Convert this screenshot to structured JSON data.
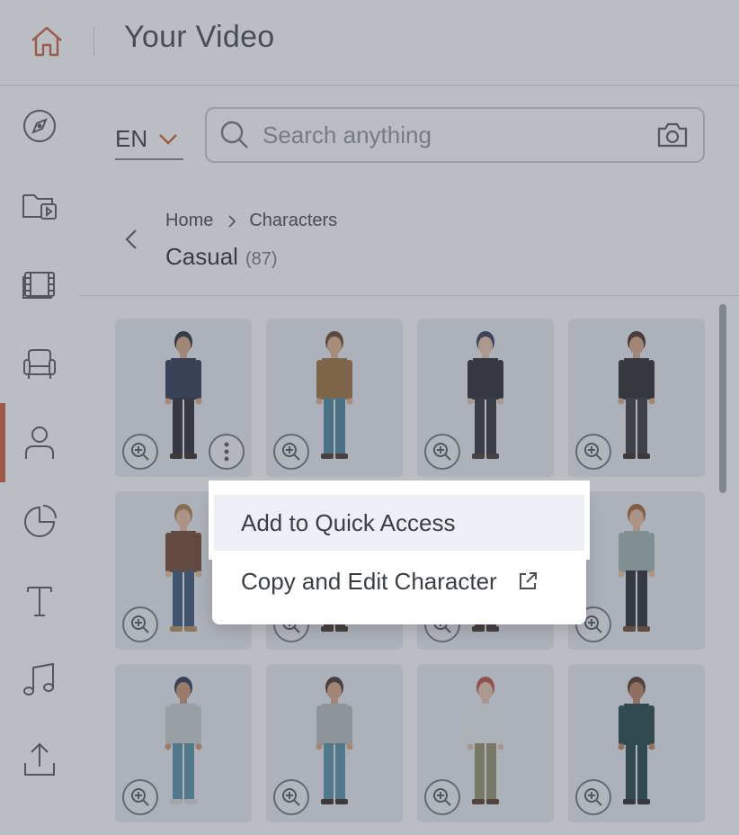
{
  "header": {
    "title": "Your Video",
    "home_icon": "home-icon"
  },
  "sidebar": {
    "items": [
      {
        "name": "explore",
        "icon": "compass-icon"
      },
      {
        "name": "media",
        "icon": "folder-video-icon"
      },
      {
        "name": "scenes",
        "icon": "film-icon"
      },
      {
        "name": "props",
        "icon": "armchair-icon"
      },
      {
        "name": "characters",
        "icon": "person-icon",
        "active": true
      },
      {
        "name": "charts",
        "icon": "pie-chart-icon"
      },
      {
        "name": "text",
        "icon": "text-icon"
      },
      {
        "name": "audio",
        "icon": "music-note-icon"
      },
      {
        "name": "upload",
        "icon": "upload-icon"
      }
    ]
  },
  "language": {
    "value": "EN"
  },
  "search": {
    "placeholder": "Search anything"
  },
  "breadcrumb": {
    "items": [
      "Home",
      "Characters"
    ]
  },
  "category": {
    "title": "Casual",
    "count": "(87)"
  },
  "characters": [
    {
      "name": "character-1",
      "hair": "#1e2226",
      "skin": "#d9a07a",
      "top": "#1f2a44",
      "pants": "#1c1d22",
      "shoes": "#2a1e17"
    },
    {
      "name": "character-2",
      "hair": "#5a3b22",
      "skin": "#e0ab84",
      "top": "#9a6a33",
      "pants": "#3f7a95",
      "shoes": "#3b2a1f"
    },
    {
      "name": "character-3",
      "hair": "#2a2f4a",
      "skin": "#e6c0a8",
      "top": "#1b1b20",
      "pants": "#23222a",
      "shoes": "#3b2a2a"
    },
    {
      "name": "character-4",
      "hair": "#3b2418",
      "skin": "#d9a07a",
      "top": "#1b1b1e",
      "pants": "#2a2b2e",
      "shoes": "#2a1e17"
    },
    {
      "name": "character-5",
      "hair": "#a8793f",
      "skin": "#e6b898",
      "top": "#6a3a22",
      "pants": "#2e4a6e",
      "shoes": "#b38a55"
    },
    {
      "name": "character-6",
      "hair": "#2b211a",
      "skin": "#d9a07a",
      "top": "#333",
      "pants": "#2a2b2e",
      "shoes": "#3b2a1f"
    },
    {
      "name": "character-7",
      "hair": "#2b211a",
      "skin": "#d9a07a",
      "top": "#333",
      "pants": "#2a2b2e",
      "shoes": "#3b2a1f"
    },
    {
      "name": "character-8",
      "hair": "#9a5a2c",
      "skin": "#e6b898",
      "top": "#9fb0ad",
      "pants": "#1b1d22",
      "shoes": "#6a3f22"
    },
    {
      "name": "character-9",
      "hair": "#1f2a44",
      "skin": "#c98d66",
      "top": "#c9cbcf",
      "pants": "#4d8aa0",
      "shoes": "#d6d6d6"
    },
    {
      "name": "character-10",
      "hair": "#3b2a1f",
      "skin": "#d9a07a",
      "top": "#b6b8bc",
      "pants": "#4d8aa0",
      "shoes": "#2a1e17"
    },
    {
      "name": "character-11",
      "hair": "#b5473a",
      "skin": "#e6c0a8",
      "top": "#e9ebee",
      "pants": "#8d8a5e",
      "shoes": "#4a2e1d"
    },
    {
      "name": "character-12",
      "hair": "#4a2e1d",
      "skin": "#b87a55",
      "top": "#133a3a",
      "pants": "#133a3a",
      "shoes": "#1b1b1e"
    }
  ],
  "context_menu": {
    "items": [
      {
        "label": "Add to Quick Access"
      },
      {
        "label": "Copy and Edit Character"
      }
    ]
  },
  "colors": {
    "accent": "#c9552a",
    "card": "#e8ebef"
  }
}
